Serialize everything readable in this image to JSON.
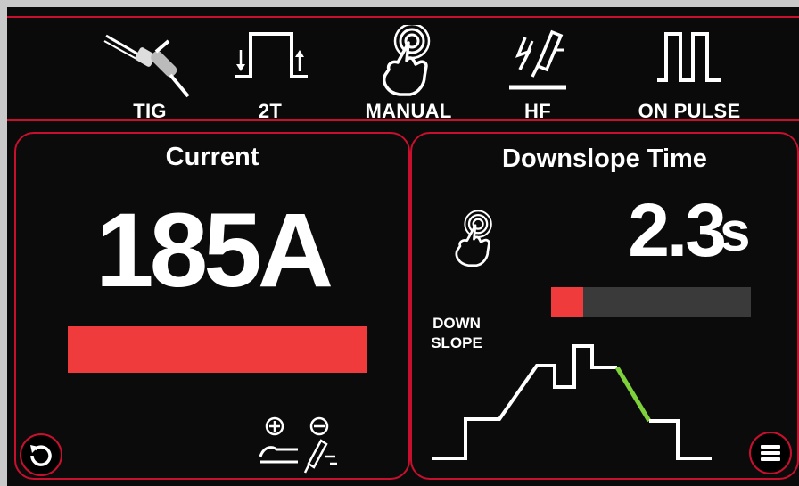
{
  "modes": [
    {
      "label": "TIG",
      "icon": "tig-torch-icon"
    },
    {
      "label": "2T",
      "icon": "two-step-trigger-icon"
    },
    {
      "label": "MANUAL",
      "icon": "touch-hand-icon"
    },
    {
      "label": "HF",
      "icon": "high-frequency-icon"
    },
    {
      "label": "ON PULSE",
      "icon": "pulse-wave-icon"
    }
  ],
  "current_panel": {
    "title": "Current",
    "value": "185A",
    "bar_fraction": 1.0,
    "polarity_icon": "polarity-dcen-icon",
    "reset_icon": "reset-icon"
  },
  "downslope_panel": {
    "title": "Downslope Time",
    "value": "2.3",
    "unit": "s",
    "bar_fraction": 0.16,
    "label_line1": "DOWN",
    "label_line2": "SLOPE",
    "graph_icon": "weld-sequence-graph-icon",
    "menu_icon": "menu-icon"
  },
  "colors": {
    "accent": "#c8102e",
    "bar": "#ef3b3b",
    "highlight_segment": "#7fd13b",
    "background": "#0a0a0a"
  }
}
